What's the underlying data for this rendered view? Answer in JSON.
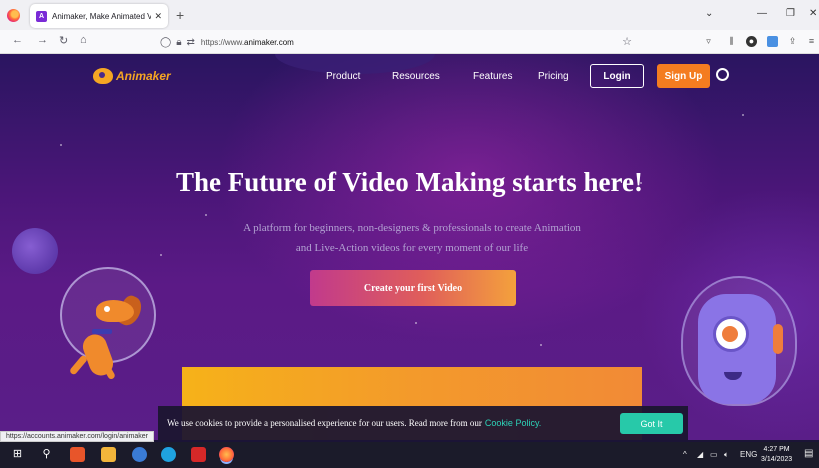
{
  "browser": {
    "tab_title": "Animaker, Make Animated Vid",
    "url_prefix": "https://www.",
    "url_domain": "animaker.com",
    "status_url": "https://accounts.animaker.com/login/animaker"
  },
  "site": {
    "logo_text": "Animaker",
    "nav": [
      "Product",
      "Resources",
      "Features",
      "Pricing"
    ],
    "login_label": "Login",
    "signup_label": "Sign Up"
  },
  "hero": {
    "title": "The Future of Video Making starts here!",
    "subtitle_line1": "A platform for beginners, non-designers & professionals to create Animation",
    "subtitle_line2": "and Live-Action videos for every moment of our life",
    "cta_label": "Create your first Video"
  },
  "cookie": {
    "text": "We use cookies to provide a personalised experience for our users. Read more from our",
    "link": "Cookie Policy.",
    "button": "Got It"
  },
  "taskbar": {
    "lang": "ENG",
    "time": "4:27 PM",
    "date": "3/14/2023"
  },
  "colors": {
    "brand_orange": "#f47c20",
    "cookie_teal": "#27c9a9",
    "page_purple": "#4a1678"
  }
}
